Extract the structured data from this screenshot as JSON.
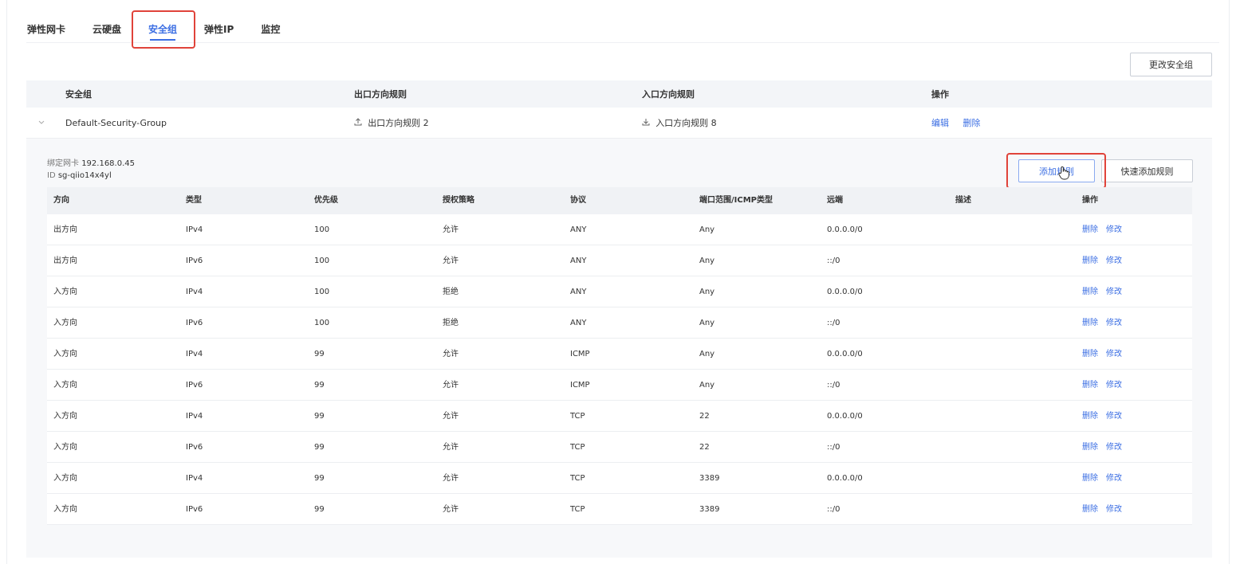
{
  "tabs": [
    {
      "label": "弹性网卡",
      "active": false
    },
    {
      "label": "云硬盘",
      "active": false
    },
    {
      "label": "安全组",
      "active": true
    },
    {
      "label": "弹性IP",
      "active": false
    },
    {
      "label": "监控",
      "active": false
    }
  ],
  "toolbar": {
    "change_group_label": "更改安全组"
  },
  "group_table": {
    "headers": [
      "安全组",
      "出口方向规则",
      "入口方向规则",
      "操作"
    ],
    "row": {
      "name": "Default-Security-Group",
      "egress": "出口方向规则 2",
      "ingress": "入口方向规则 8",
      "actions": [
        "编辑",
        "删除"
      ]
    }
  },
  "detail": {
    "bound_nic_label": "绑定网卡",
    "bound_nic_value": "192.168.0.45",
    "id_label": "ID",
    "id_value": "sg-qiio14x4yl",
    "add_rule_label": "添加规则",
    "quick_add_label": "快速添加规则"
  },
  "rules_table": {
    "headers": [
      "方向",
      "类型",
      "优先级",
      "授权策略",
      "协议",
      "端口范围/ICMP类型",
      "远端",
      "描述",
      "操作"
    ],
    "rows": [
      [
        "出方向",
        "IPv4",
        "100",
        "允许",
        "ANY",
        "Any",
        "0.0.0.0/0",
        ""
      ],
      [
        "出方向",
        "IPv6",
        "100",
        "允许",
        "ANY",
        "Any",
        "::/0",
        ""
      ],
      [
        "入方向",
        "IPv4",
        "100",
        "拒绝",
        "ANY",
        "Any",
        "0.0.0.0/0",
        ""
      ],
      [
        "入方向",
        "IPv6",
        "100",
        "拒绝",
        "ANY",
        "Any",
        "::/0",
        ""
      ],
      [
        "入方向",
        "IPv4",
        "99",
        "允许",
        "ICMP",
        "Any",
        "0.0.0.0/0",
        ""
      ],
      [
        "入方向",
        "IPv6",
        "99",
        "允许",
        "ICMP",
        "Any",
        "::/0",
        ""
      ],
      [
        "入方向",
        "IPv4",
        "99",
        "允许",
        "TCP",
        "22",
        "0.0.0.0/0",
        ""
      ],
      [
        "入方向",
        "IPv6",
        "99",
        "允许",
        "TCP",
        "22",
        "::/0",
        ""
      ],
      [
        "入方向",
        "IPv4",
        "99",
        "允许",
        "TCP",
        "3389",
        "0.0.0.0/0",
        ""
      ],
      [
        "入方向",
        "IPv6",
        "99",
        "允许",
        "TCP",
        "3389",
        "::/0",
        ""
      ]
    ],
    "row_actions": [
      "删除",
      "修改"
    ]
  },
  "icons": {
    "expander": "chevron-down-icon",
    "egress": "upload-icon",
    "ingress": "download-icon",
    "cursor": "hand-pointer-icon"
  },
  "colors": {
    "accent": "#3b6ee3",
    "highlight": "#e0433a",
    "header_bg": "#f3f5f8"
  }
}
